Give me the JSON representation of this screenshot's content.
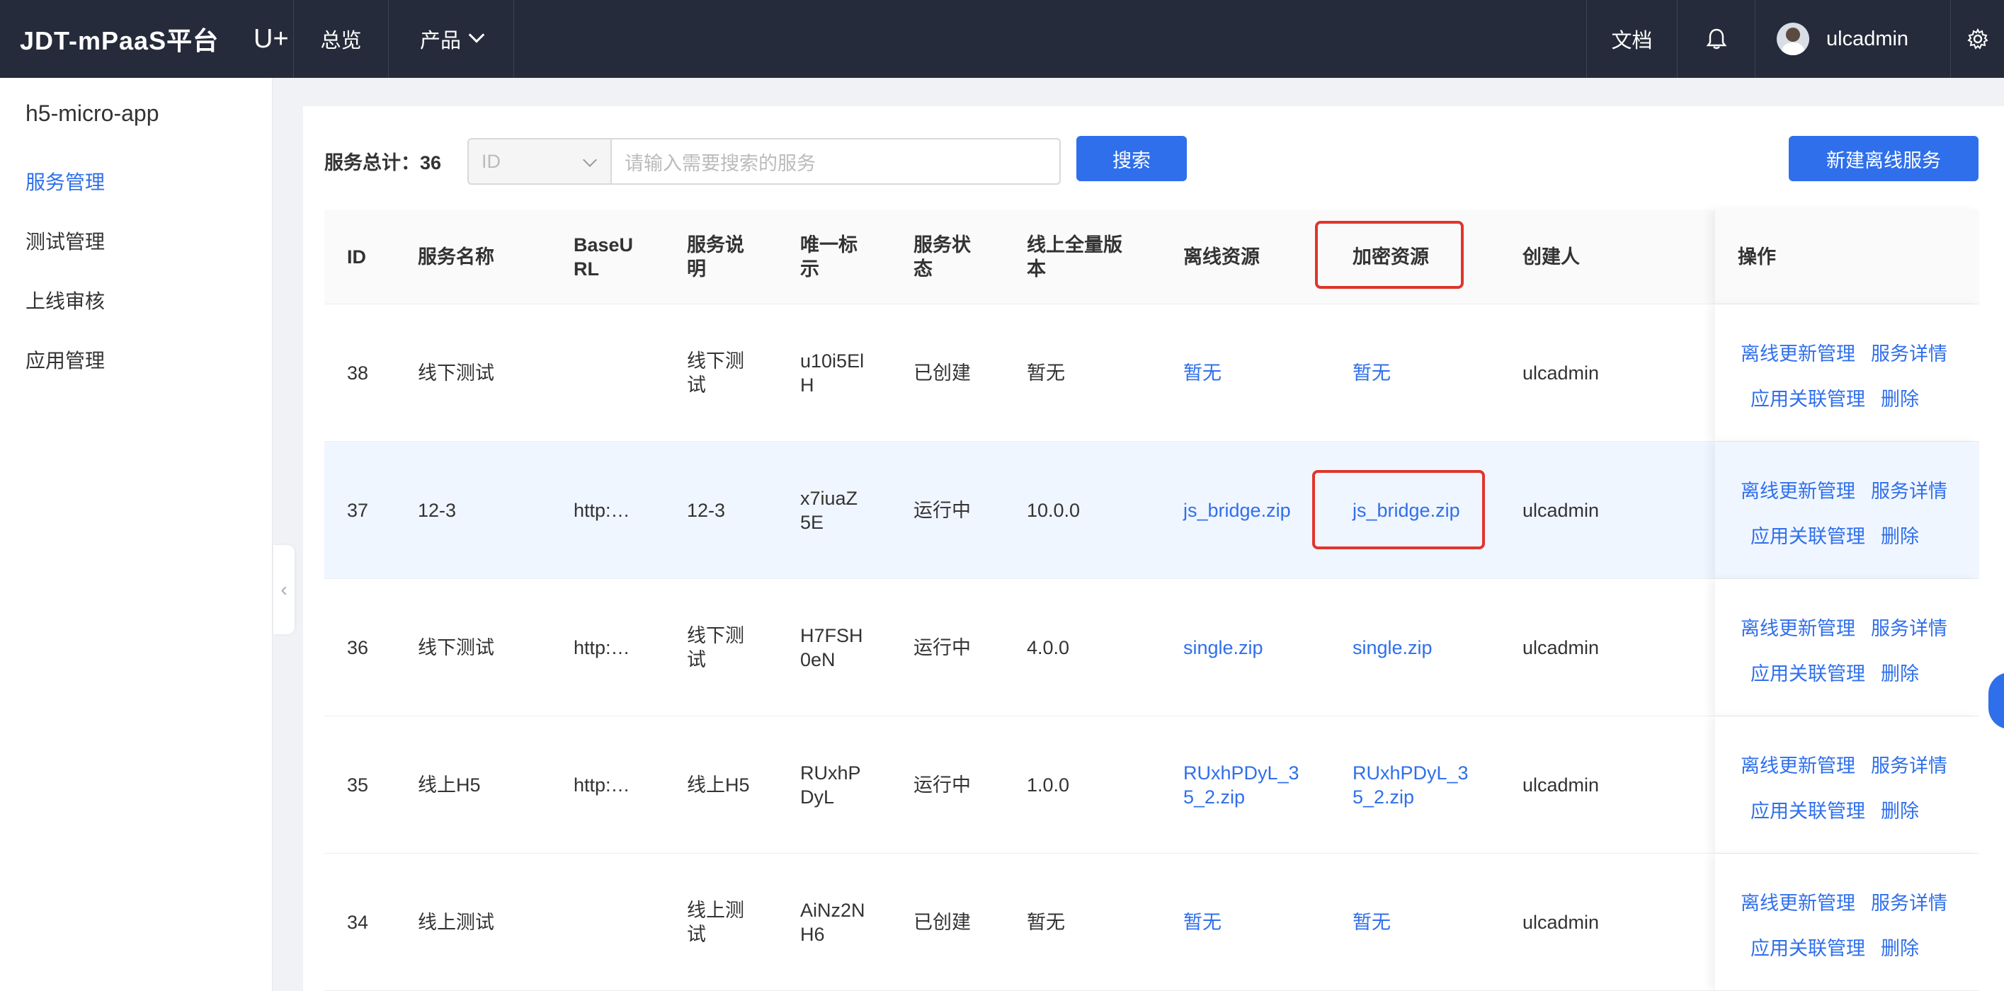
{
  "topbar": {
    "brand": "JDT-mPaaS平台",
    "brand_u": "U+",
    "nav_overview": "总览",
    "nav_product": "产品",
    "docs": "文档",
    "username": "ulcadmin"
  },
  "sidebar": {
    "app_name": "h5-micro-app",
    "items": [
      {
        "label": "服务管理",
        "active": true
      },
      {
        "label": "测试管理"
      },
      {
        "label": "上线审核"
      },
      {
        "label": "应用管理"
      }
    ]
  },
  "toolbar": {
    "total_label": "服务总计：",
    "total_value": "36",
    "select_value": "ID",
    "search_placeholder": "请输入需要搜索的服务",
    "search_button": "搜索",
    "new_button": "新建离线服务"
  },
  "table": {
    "headers": {
      "id": "ID",
      "name": "服务名称",
      "baseurl": "BaseU RL",
      "desc": "服务说 明",
      "uid": "唯一标 示",
      "status": "服务状 态",
      "version": "线上全量版 本",
      "offline": "离线资源",
      "encrypted": "加密资源",
      "creator": "创建人",
      "ops": "操作"
    },
    "rows": [
      {
        "id": "38",
        "name": "线下测试",
        "baseurl": "",
        "desc": "线下测 试",
        "uid": "u10i5El H",
        "status": "已创建",
        "version": "暂无",
        "offline": "暂无",
        "encrypted": "暂无",
        "creator": "ulcadmin"
      },
      {
        "id": "37",
        "name": "12-3",
        "baseurl": "http:…",
        "desc": "12-3",
        "uid": "x7iuaZ 5E",
        "status": "运行中",
        "version": "10.0.0",
        "offline": "js_bridge.zip",
        "encrypted": "js_bridge.zip",
        "creator": "ulcadmin"
      },
      {
        "id": "36",
        "name": "线下测试",
        "baseurl": "http:…",
        "desc": "线下测 试",
        "uid": "H7FSH 0eN",
        "status": "运行中",
        "version": "4.0.0",
        "offline": "single.zip",
        "encrypted": "single.zip",
        "creator": "ulcadmin"
      },
      {
        "id": "35",
        "name": "线上H5",
        "baseurl": "http:…",
        "desc": "线上H5",
        "uid": "RUxhP DyL",
        "status": "运行中",
        "version": "1.0.0",
        "offline": "RUxhPDyL_3 5_2.zip",
        "encrypted": "RUxhPDyL_3 5_2.zip",
        "creator": "ulcadmin"
      },
      {
        "id": "34",
        "name": "线上测试",
        "baseurl": "",
        "desc": "线上测 试",
        "uid": "AiNz2N H6",
        "status": "已创建",
        "version": "暂无",
        "offline": "暂无",
        "encrypted": "暂无",
        "creator": "ulcadmin"
      }
    ],
    "ops": {
      "offline_update": "离线更新管理",
      "detail": "服务详情",
      "app_link": "应用关联管理",
      "delete": "删除"
    }
  },
  "colors": {
    "topbar": "#262b3b",
    "primary": "#2f6feb",
    "highlight_box": "#e0352b",
    "selected_row": "#f0f6ff"
  },
  "icons": [
    "bell-icon",
    "settings-gear-icon",
    "user-avatar",
    "chevron-down-icon",
    "collapse-left-icon"
  ]
}
